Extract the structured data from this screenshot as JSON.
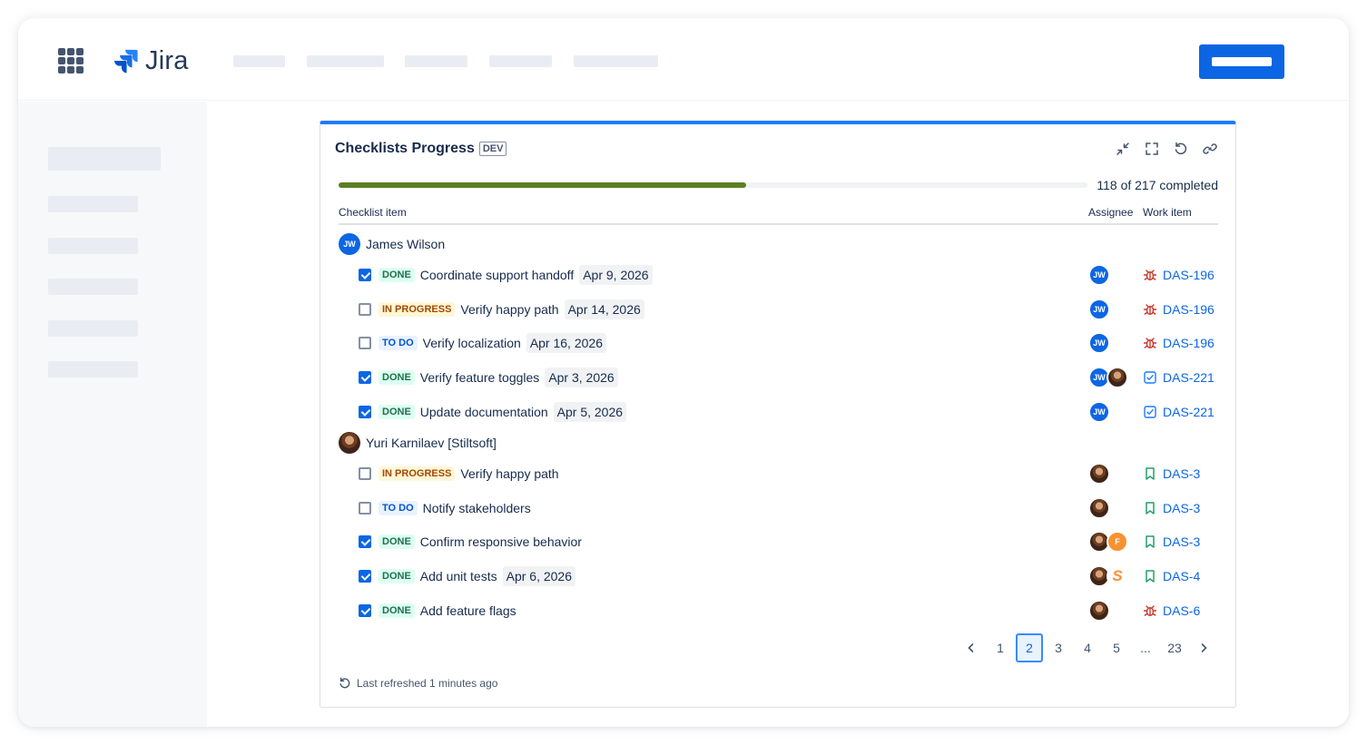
{
  "app": {
    "name": "Jira"
  },
  "panel": {
    "title": "Checklists Progress",
    "env_badge": "DEV",
    "tools": [
      "collapse-icon",
      "fullscreen-icon",
      "refresh-icon",
      "link-icon"
    ]
  },
  "progress": {
    "completed": 118,
    "total": 217,
    "fraction": 0.544,
    "label": "118 of 217 completed",
    "color": "#5b7f24"
  },
  "table": {
    "headers": {
      "item": "Checklist item",
      "assignee": "Assignee",
      "work_item": "Work item"
    }
  },
  "groups": [
    {
      "name": "James Wilson",
      "initials": "JW",
      "items": [
        {
          "checked": true,
          "status": "DONE",
          "text": "Coordinate support handoff",
          "date": "Apr 9, 2026",
          "work": "DAS-196",
          "work_icon": "bug-icon"
        },
        {
          "checked": false,
          "status": "IN PROGRESS",
          "text": "Verify happy path",
          "date": "Apr 14, 2026",
          "work": "DAS-196",
          "work_icon": "bug-icon"
        },
        {
          "checked": false,
          "status": "TO DO",
          "text": "Verify localization",
          "date": "Apr 16, 2026",
          "work": "DAS-196",
          "work_icon": "bug-icon"
        },
        {
          "checked": true,
          "status": "DONE",
          "text": "Verify feature toggles",
          "date": "Apr 3, 2026",
          "work": "DAS-221",
          "work_icon": "task-icon"
        },
        {
          "checked": true,
          "status": "DONE",
          "text": "Update documentation",
          "date": "Apr 5, 2026",
          "work": "DAS-221",
          "work_icon": "task-icon"
        }
      ]
    },
    {
      "name": "Yuri Karnilaev [Stiltsoft]",
      "items": [
        {
          "checked": false,
          "status": "IN PROGRESS",
          "text": "Verify happy path",
          "date": "",
          "work": "DAS-3",
          "work_icon": "story-icon"
        },
        {
          "checked": false,
          "status": "TO DO",
          "text": "Notify stakeholders",
          "date": "",
          "work": "DAS-3",
          "work_icon": "story-icon"
        },
        {
          "checked": true,
          "status": "DONE",
          "text": "Confirm responsive behavior",
          "date": "",
          "work": "DAS-3",
          "work_icon": "story-icon",
          "extra_avatar": "F"
        },
        {
          "checked": true,
          "status": "DONE",
          "text": "Add unit tests",
          "date": "Apr 6, 2026",
          "work": "DAS-4",
          "work_icon": "story-icon",
          "extra_avatar": "S"
        },
        {
          "checked": true,
          "status": "DONE",
          "text": "Add feature flags",
          "date": "",
          "work": "DAS-6",
          "work_icon": "bug-icon"
        }
      ]
    }
  ],
  "pagination": {
    "pages": [
      "1",
      "2",
      "3",
      "4",
      "5",
      "...",
      "23"
    ],
    "current": "2"
  },
  "footer": {
    "refreshed": "Last refreshed 1 minutes ago"
  },
  "colors": {
    "accent": "#0c66e4",
    "done": "#216e4e",
    "in_progress": "#a54800",
    "todo": "#0055cc",
    "bug": "#c9372c",
    "story": "#22a06b"
  }
}
